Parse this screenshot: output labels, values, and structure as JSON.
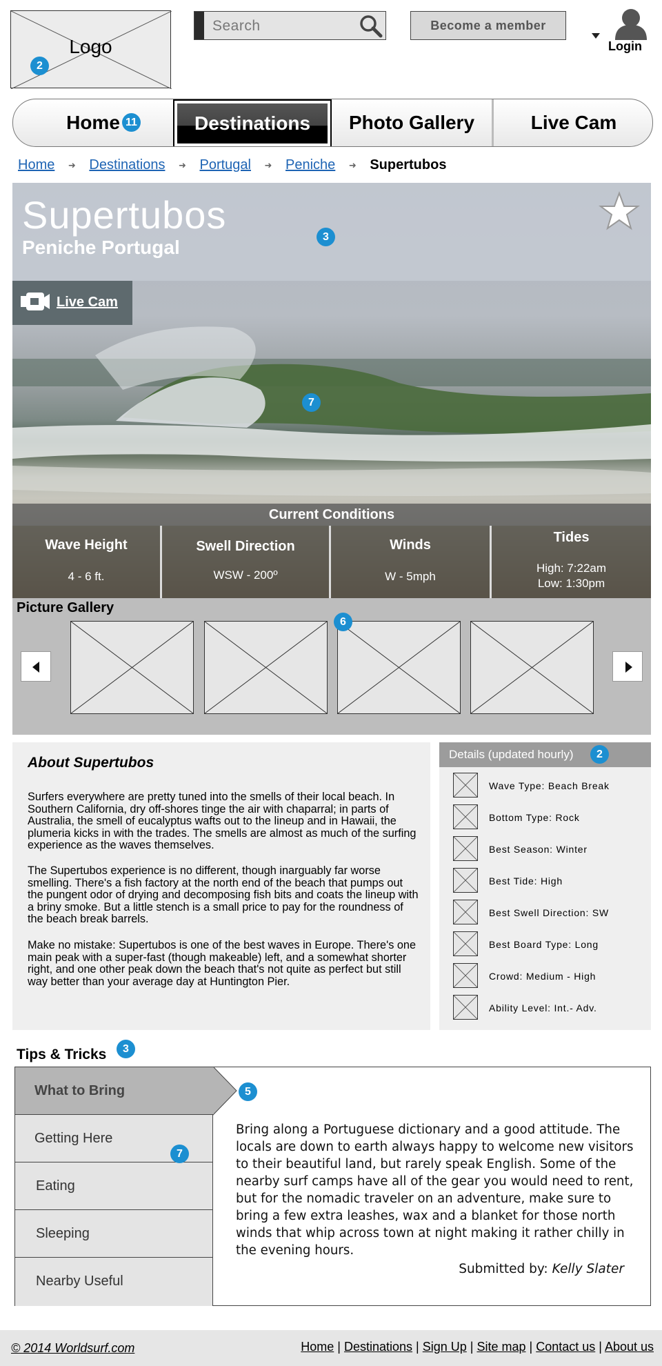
{
  "header": {
    "logo_text": "Logo",
    "search_placeholder": "Search",
    "member_button": "Become a member",
    "login_label": "Login"
  },
  "nav": {
    "items": [
      {
        "label": "Home"
      },
      {
        "label": "Destinations",
        "active": true
      },
      {
        "label": "Photo Gallery"
      },
      {
        "label": "Live Cam"
      }
    ]
  },
  "breadcrumb": {
    "items": [
      "Home",
      "Destinations",
      "Portugal",
      "Peniche"
    ],
    "current": "Supertubos"
  },
  "hero": {
    "title": "Supertubos",
    "subtitle": "Peniche Portugal",
    "livecam_label": "Live Cam"
  },
  "conditions": {
    "heading": "Current Conditions",
    "items": [
      {
        "label": "Wave Height",
        "value": "4 - 6 ft."
      },
      {
        "label": "Swell Direction",
        "value": "WSW - 200º"
      },
      {
        "label": "Winds",
        "value": "W - 5mph"
      },
      {
        "label": "Tides",
        "value": "High: 7:22am",
        "value2": "Low: 1:30pm"
      }
    ]
  },
  "gallery": {
    "title": "Picture Gallery"
  },
  "about": {
    "title": "About Supertubos",
    "paragraphs": [
      "Surfers everywhere are pretty tuned into the smells of their local beach. In Southern California, dry off-shores tinge the air with chaparral; in parts of Australia, the smell of eucalyptus wafts out to the lineup and in Hawaii, the plumeria kicks in with the trades. The smells are almost as much of the surfing experience as the waves themselves.",
      "The Supertubos experience is no different, though inarguably far worse smelling. There's a fish factory at the north end of the beach that pumps out the pungent odor of drying and decomposing fish bits and coats the lineup with a briny smoke. But a little stench is a small price to pay for the roundness of the beach break barrels.",
      "Make no mistake: Supertubos is one of the best waves in Europe. There's one main peak with a super-fast (though makeable) left, and a somewhat shorter right, and one other peak down the beach that's not quite as perfect but still way better than your average day at Huntington Pier."
    ]
  },
  "details": {
    "heading": "Details (updated hourly)",
    "items": [
      "Wave Type: Beach Break",
      "Bottom Type: Rock",
      "Best Season: Winter",
      "Best Tide: High",
      "Best Swell Direction:  SW",
      "Best Board Type: Long",
      "Crowd: Medium - High",
      "Ability Level: Int.- Adv."
    ]
  },
  "tips": {
    "title": "Tips & Tricks",
    "tabs": [
      "What to Bring",
      "Getting Here",
      "Eating",
      "Sleeping",
      "Nearby Useful"
    ],
    "active_tab": "What to Bring",
    "content": "Bring along a Portuguese  dictionary and a good attitude. The locals are down to earth always happy to welcome new visitors to their beautiful land, but rarely speak English. Some of the nearby surf camps have all of the gear you would need to rent, but for the nomadic traveler on an adventure, make sure to  bring a few extra leashes, wax and a blanket for those north winds that whip across town at night making it rather chilly in the evening hours.",
    "submitted_label": "Submitted by:",
    "submitted_name": "Kelly Slater"
  },
  "footer": {
    "copyright": "© 2014 Worldsurf.com",
    "links": [
      "Home",
      "Destinations",
      "Sign Up",
      "Site map",
      "Contact us",
      "About us"
    ]
  },
  "annotations": {
    "logo": "2",
    "nav": "11",
    "hero": "3",
    "photo": "7",
    "gallery": "6",
    "details": "2",
    "tips": "3",
    "tabs_arrow": "5",
    "tabs": "7"
  },
  "colors": {
    "annotation_badge": "#1c8fd1",
    "link": "#1e64b4",
    "nav_active_bg": "#000000",
    "details_header": "#9c9c9c"
  }
}
